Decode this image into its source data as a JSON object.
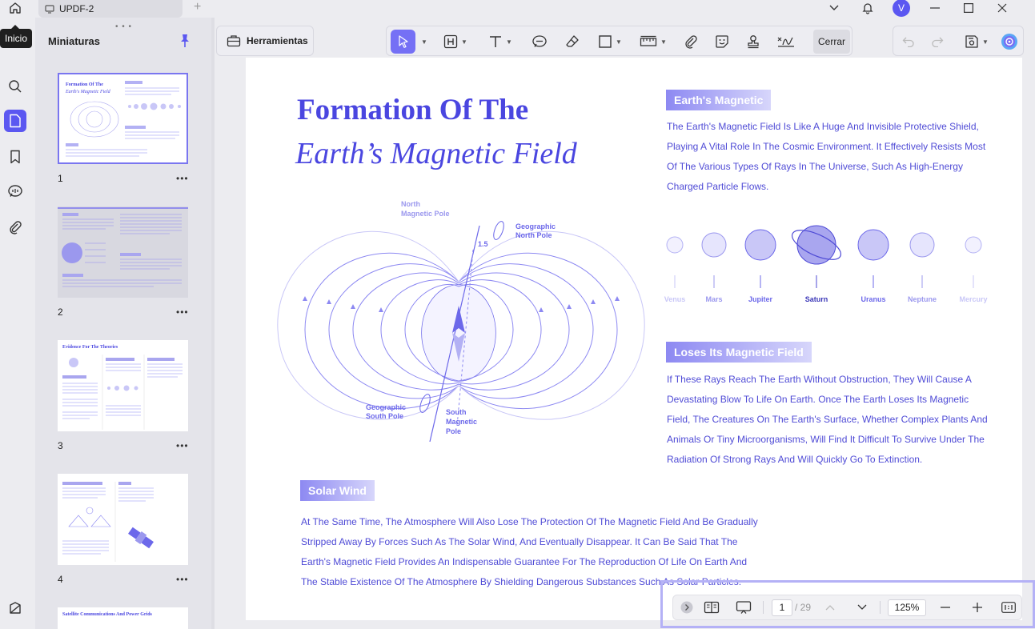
{
  "titlebar": {
    "tab_title": "UPDF-2",
    "avatar_letter": "V"
  },
  "tooltip": {
    "inicio": "Inicio"
  },
  "thumbnails": {
    "title": "Miniaturas",
    "handle": "• • •",
    "pages": [
      "1",
      "2",
      "3",
      "4"
    ],
    "more": "•••",
    "thumb3_title": "Evidence For The Theories",
    "thumb5_title": "Satellite Communications And Power Grids"
  },
  "toolbar": {
    "tools_label": "Herramientas",
    "close_label": "Cerrar"
  },
  "document": {
    "title_line1": "Formation Of The",
    "title_line2": "Earth’s Magnetic Field",
    "section1": {
      "tag": "Earth's Magnetic",
      "lines": [
        "The Earth's Magnetic Field Is Like A Huge And Invisible Protective Shield,",
        "Playing A Vital Role In The Cosmic Environment. It Effectively Resists Most",
        "Of The Various Types Of Rays In The Universe, Such As High-Energy",
        "Charged Particle Flows."
      ]
    },
    "section2": {
      "tag": "Loses Its Magnetic Field",
      "lines": [
        "If These Rays Reach The Earth Without Obstruction, They Will Cause A",
        "Devastating Blow To Life On Earth. Once The Earth Loses Its Magnetic",
        "Field, The Creatures On The Earth's Surface, Whether Complex Plants And",
        "Animals Or Tiny Microorganisms, Will Find It Difficult To Survive Under The",
        "Radiation Of Strong Rays And Will Quickly Go To Extinction."
      ]
    },
    "section3": {
      "tag": "Solar Wind",
      "lines": [
        "At The Same Time, The Atmosphere Will Also Lose The Protection Of The Magnetic Field And Be Gradually",
        "Stripped Away By Forces Such As The Solar Wind, And Eventually Disappear. It Can Be Said That The",
        "Earth's Magnetic Field Provides An Indispensable Guarantee For The Reproduction Of Life On Earth And",
        "The Stable Existence Of The Atmosphere By Shielding Dangerous Substances Such As Solar Particles."
      ]
    },
    "diagram": {
      "north_magnetic_pole": [
        "North",
        "Magnetic Pole"
      ],
      "geographic_north_pole": [
        "Geographic",
        "North Pole"
      ],
      "angle": "1.5",
      "geographic_south_pole": [
        "Geographic",
        "South Pole"
      ],
      "south_magnetic_pole": [
        "South",
        "Magnetic",
        "Pole"
      ]
    },
    "planets": [
      "Venus",
      "Mars",
      "Jupiter",
      "Saturn",
      "Uranus",
      "Neptune",
      "Mercury"
    ]
  },
  "navbar": {
    "page": "1",
    "total": "/ 29",
    "zoom": "125%"
  },
  "colors": {
    "accent": "#5b57f1",
    "doc_text": "#4f4bd6",
    "title": "#4a46e0"
  }
}
